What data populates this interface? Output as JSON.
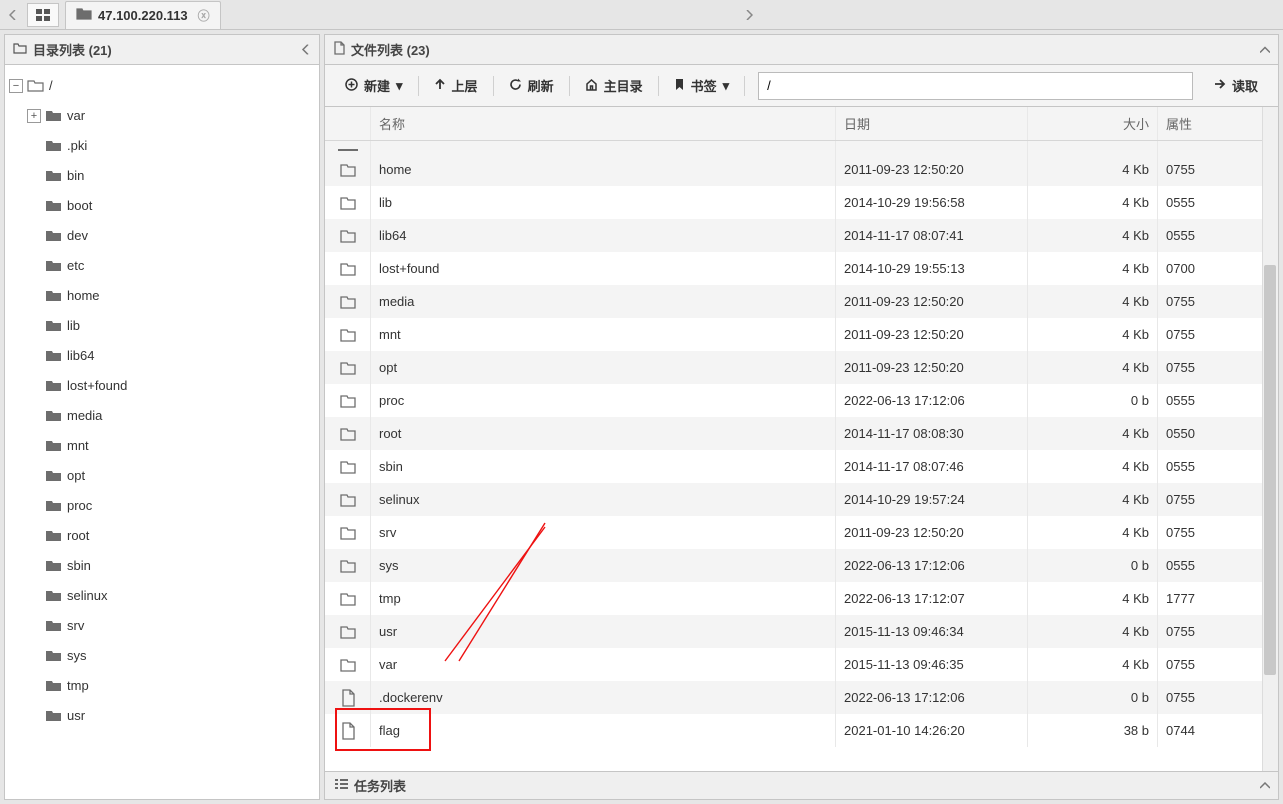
{
  "tab": {
    "title": "47.100.220.113"
  },
  "directory_panel": {
    "title": "目录列表 (21)"
  },
  "file_panel": {
    "title": "文件列表 (23)"
  },
  "toolbar": {
    "new": "新建",
    "up": "上层",
    "refresh": "刷新",
    "home": "主目录",
    "bookmark": "书签",
    "read": "读取"
  },
  "path_input": {
    "value": "/"
  },
  "columns": {
    "name": "名称",
    "date": "日期",
    "size": "大小",
    "attr": "属性"
  },
  "task_panel": {
    "title": "任务列表"
  },
  "tree": {
    "root": "/",
    "children": [
      "var",
      ".pki",
      "bin",
      "boot",
      "dev",
      "etc",
      "home",
      "lib",
      "lib64",
      "lost+found",
      "media",
      "mnt",
      "opt",
      "proc",
      "root",
      "sbin",
      "selinux",
      "srv",
      "sys",
      "tmp",
      "usr"
    ],
    "expandable": {
      "var": true
    }
  },
  "files": [
    {
      "type": "dir",
      "name": "home",
      "date": "2011-09-23 12:50:20",
      "size": "4 Kb",
      "attr": "0755"
    },
    {
      "type": "dir",
      "name": "lib",
      "date": "2014-10-29 19:56:58",
      "size": "4 Kb",
      "attr": "0555"
    },
    {
      "type": "dir",
      "name": "lib64",
      "date": "2014-11-17 08:07:41",
      "size": "4 Kb",
      "attr": "0555"
    },
    {
      "type": "dir",
      "name": "lost+found",
      "date": "2014-10-29 19:55:13",
      "size": "4 Kb",
      "attr": "0700"
    },
    {
      "type": "dir",
      "name": "media",
      "date": "2011-09-23 12:50:20",
      "size": "4 Kb",
      "attr": "0755"
    },
    {
      "type": "dir",
      "name": "mnt",
      "date": "2011-09-23 12:50:20",
      "size": "4 Kb",
      "attr": "0755"
    },
    {
      "type": "dir",
      "name": "opt",
      "date": "2011-09-23 12:50:20",
      "size": "4 Kb",
      "attr": "0755"
    },
    {
      "type": "dir",
      "name": "proc",
      "date": "2022-06-13 17:12:06",
      "size": "0 b",
      "attr": "0555"
    },
    {
      "type": "dir",
      "name": "root",
      "date": "2014-11-17 08:08:30",
      "size": "4 Kb",
      "attr": "0550"
    },
    {
      "type": "dir",
      "name": "sbin",
      "date": "2014-11-17 08:07:46",
      "size": "4 Kb",
      "attr": "0555"
    },
    {
      "type": "dir",
      "name": "selinux",
      "date": "2014-10-29 19:57:24",
      "size": "4 Kb",
      "attr": "0755"
    },
    {
      "type": "dir",
      "name": "srv",
      "date": "2011-09-23 12:50:20",
      "size": "4 Kb",
      "attr": "0755"
    },
    {
      "type": "dir",
      "name": "sys",
      "date": "2022-06-13 17:12:06",
      "size": "0 b",
      "attr": "0555"
    },
    {
      "type": "dir",
      "name": "tmp",
      "date": "2022-06-13 17:12:07",
      "size": "4 Kb",
      "attr": "1777"
    },
    {
      "type": "dir",
      "name": "usr",
      "date": "2015-11-13 09:46:34",
      "size": "4 Kb",
      "attr": "0755"
    },
    {
      "type": "dir",
      "name": "var",
      "date": "2015-11-13 09:46:35",
      "size": "4 Kb",
      "attr": "0755"
    },
    {
      "type": "file",
      "name": ".dockerenv",
      "date": "2022-06-13 17:12:06",
      "size": "0 b",
      "attr": "0755"
    },
    {
      "type": "file",
      "name": "flag",
      "date": "2021-01-10 14:26:20",
      "size": "38 b",
      "attr": "0744"
    }
  ],
  "annotation": {
    "target_row_name": "flag"
  }
}
